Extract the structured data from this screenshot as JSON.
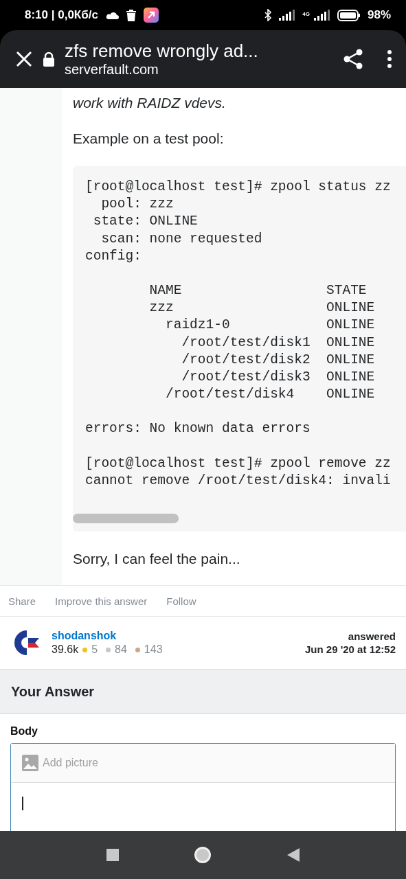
{
  "status_bar": {
    "time": "8:10 | 0,0Кб/с",
    "network_label": "4G",
    "battery": "98%"
  },
  "browser_bar": {
    "title": "zfs remove wrongly ad...",
    "url": "serverfault.com"
  },
  "answer": {
    "paragraphs": [
      {
        "text": "work with RAIDZ vdevs.",
        "italic": true
      },
      {
        "text": "Example on a test pool:",
        "italic": false
      }
    ],
    "code_groups": [
      [
        "[root@localhost test]# zpool status zz",
        "  pool: zzz",
        " state: ONLINE",
        "  scan: none requested",
        "config:"
      ],
      [
        "        NAME                  STATE",
        "        zzz                   ONLINE",
        "          raidz1-0            ONLINE",
        "            /root/test/disk1  ONLINE",
        "            /root/test/disk2  ONLINE",
        "            /root/test/disk3  ONLINE",
        "          /root/test/disk4    ONLINE"
      ],
      [
        "errors: No known data errors"
      ],
      [
        "[root@localhost test]# zpool remove zz",
        "cannot remove /root/test/disk4: invali"
      ]
    ],
    "closing": "Sorry, I can feel the pain...",
    "actions": [
      "Share",
      "Improve this answer",
      "Follow"
    ],
    "user": {
      "name": "shodanshok",
      "reputation": "39.6k",
      "badges": [
        {
          "count": "5",
          "color": "#f1c40f"
        },
        {
          "count": "84",
          "color": "#c8c8c8"
        },
        {
          "count": "143",
          "color": "#d1a684"
        }
      ]
    },
    "answered_label": "answered",
    "answered_date": "Jun 29 '20 at 12:52"
  },
  "your_answer": {
    "heading": "Your Answer",
    "body_label": "Body",
    "toolbar_button": "Add picture"
  }
}
